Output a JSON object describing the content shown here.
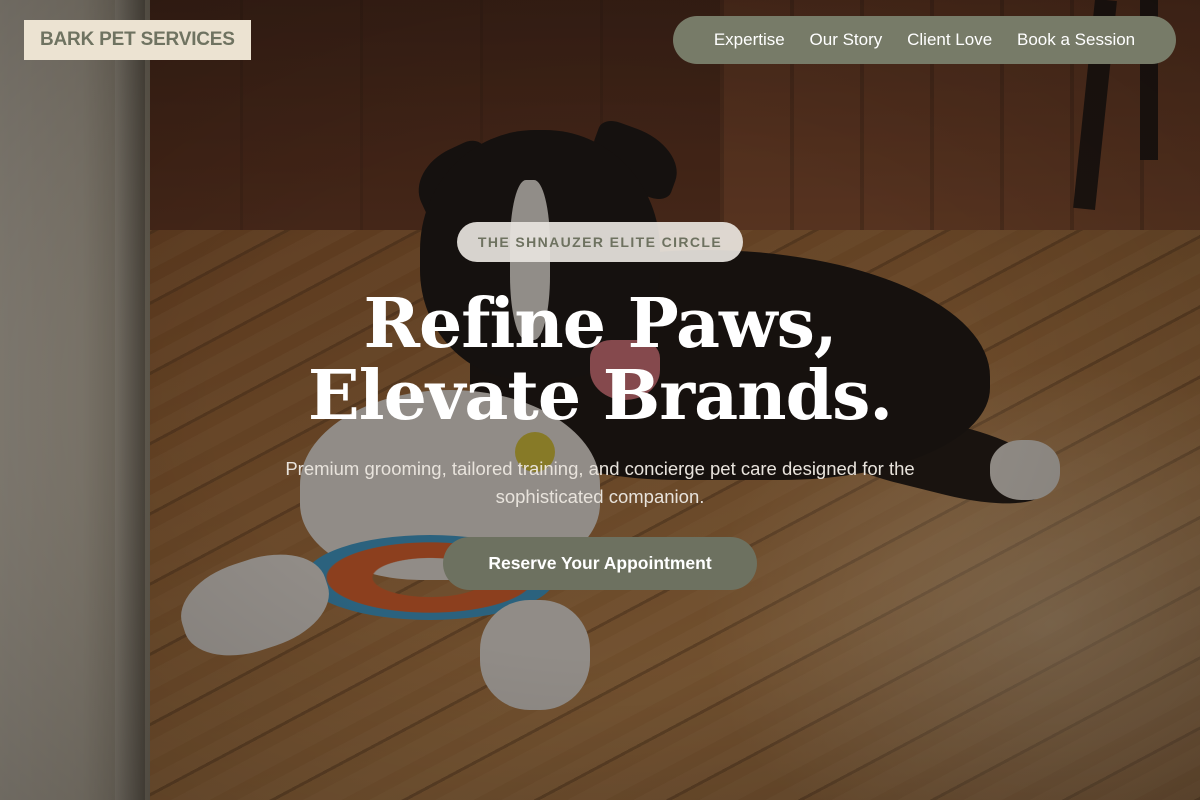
{
  "brand": {
    "name": "BARK PET SERVICES"
  },
  "nav": {
    "items": [
      {
        "label": "Expertise"
      },
      {
        "label": "Our Story"
      },
      {
        "label": "Client Love"
      },
      {
        "label": "Book a Session"
      }
    ]
  },
  "hero": {
    "badge": "THE SHNAUZER ELITE CIRCLE",
    "headline_line1": "Refine Paws,",
    "headline_line2": "Elevate Brands.",
    "subtitle": "Premium grooming, tailored training, and concierge pet care designed for the sophisticated companion.",
    "cta_label": "Reserve Your Appointment"
  },
  "colors": {
    "accent": "#6d7160",
    "nav_background": "#777b68",
    "logo_background": "#ece3d2",
    "badge_text": "#6e7260"
  }
}
